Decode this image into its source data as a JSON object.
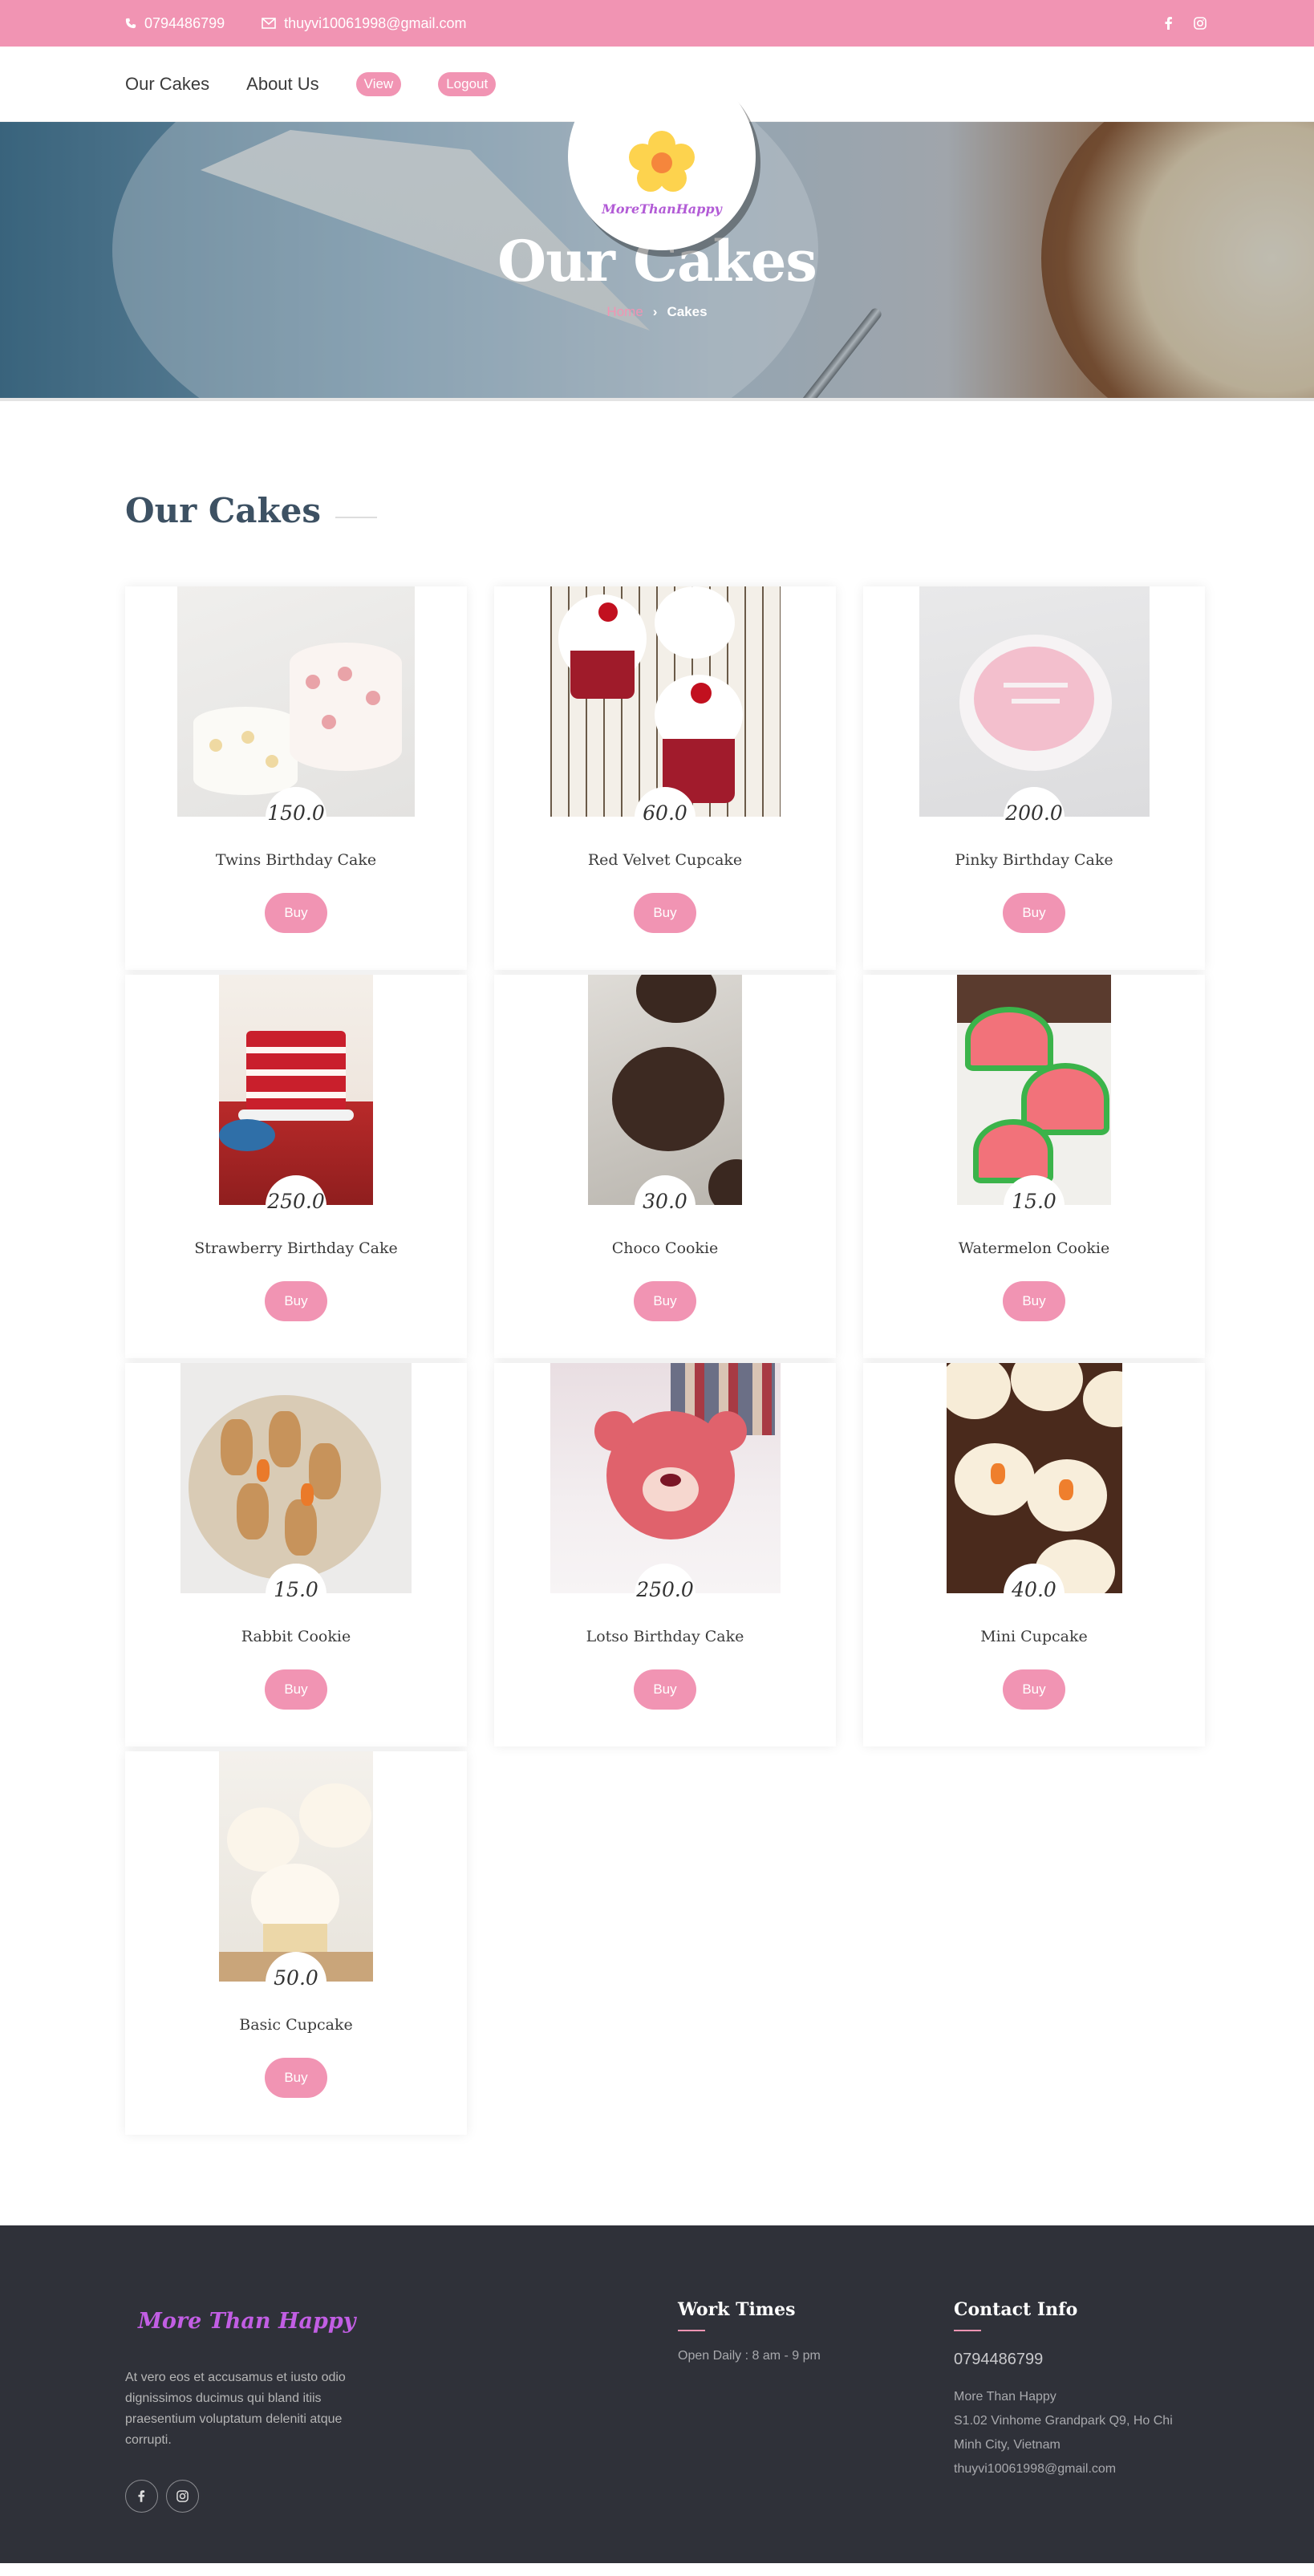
{
  "topbar": {
    "phone": "0794486799",
    "email": "thuyvi10061998@gmail.com",
    "icons": [
      "phone-icon",
      "envelope-icon",
      "facebook-icon",
      "instagram-icon"
    ]
  },
  "nav": {
    "links": [
      "Our Cakes",
      "About Us"
    ],
    "view_label": "View",
    "logout_label": "Logout",
    "logo_text": "MoreThanHappy"
  },
  "hero": {
    "title": "Our Cakes",
    "breadcrumb_home": "Home",
    "breadcrumb_sep": "›",
    "breadcrumb_current": "Cakes"
  },
  "section": {
    "title": "Our Cakes"
  },
  "products": [
    {
      "price": "150.0",
      "name": "Twins Birthday Cake",
      "buy_label": "Buy"
    },
    {
      "price": "60.0",
      "name": "Red Velvet Cupcake",
      "buy_label": "Buy"
    },
    {
      "price": "200.0",
      "name": "Pinky Birthday Cake",
      "buy_label": "Buy"
    },
    {
      "price": "250.0",
      "name": "Strawberry Birthday Cake",
      "buy_label": "Buy"
    },
    {
      "price": "30.0",
      "name": "Choco Cookie",
      "buy_label": "Buy"
    },
    {
      "price": "15.0",
      "name": "Watermelon Cookie",
      "buy_label": "Buy"
    },
    {
      "price": "15.0",
      "name": "Rabbit Cookie",
      "buy_label": "Buy"
    },
    {
      "price": "250.0",
      "name": "Lotso Birthday Cake",
      "buy_label": "Buy"
    },
    {
      "price": "40.0",
      "name": "Mini Cupcake",
      "buy_label": "Buy"
    },
    {
      "price": "50.0",
      "name": "Basic Cupcake",
      "buy_label": "Buy"
    }
  ],
  "footer": {
    "brand": "More Than Happy",
    "description": "At vero eos et accusamus et iusto odio dignissimos ducimus qui bland itiis praesentium voluptatum deleniti atque corrupti.",
    "work_title": "Work Times",
    "work_hours": "Open Daily : 8 am - 9 pm",
    "contact_title": "Contact Info",
    "contact_phone": "0794486799",
    "contact_name": "More Than Happy",
    "contact_address": "S1.02 Vinhome Grandpark Q9, Ho Chi Minh City, Vietnam",
    "contact_email": "thuyvi10061998@gmail.com"
  },
  "colors": {
    "accent": "#f194b3",
    "footer_bg": "#2f3139",
    "brand_purple": "#c25ee4",
    "title_blue": "#3d5163"
  }
}
